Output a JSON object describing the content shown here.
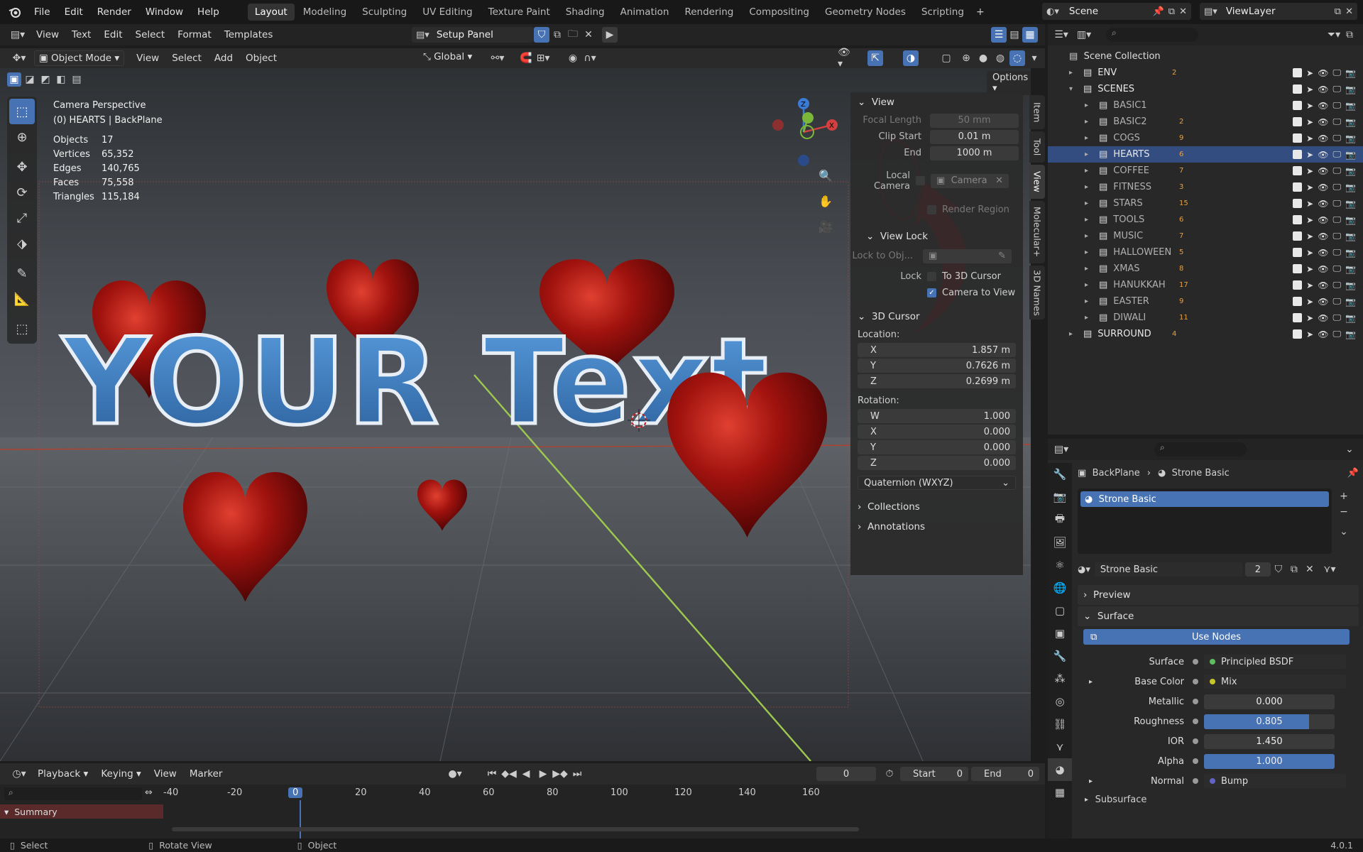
{
  "menubar": {
    "items": [
      "File",
      "Edit",
      "Render",
      "Window",
      "Help"
    ],
    "workspaces": [
      "Layout",
      "Modeling",
      "Sculpting",
      "UV Editing",
      "Texture Paint",
      "Shading",
      "Animation",
      "Rendering",
      "Compositing",
      "Geometry Nodes",
      "Scripting"
    ],
    "active_workspace": "Layout",
    "scene": "Scene",
    "view_layer": "ViewLayer"
  },
  "text_header": {
    "items": [
      "View",
      "Text",
      "Edit",
      "Select",
      "Format",
      "Templates"
    ],
    "script_name": "Setup Panel"
  },
  "viewport_header": {
    "mode": "Object Mode",
    "items": [
      "View",
      "Select",
      "Add",
      "Object"
    ],
    "orientation": "Global",
    "options": "Options"
  },
  "overlay_info": {
    "camera": "Camera Perspective",
    "context": "(0) HEARTS | BackPlane",
    "stats": [
      {
        "label": "Objects",
        "value": "17"
      },
      {
        "label": "Vertices",
        "value": "65,352"
      },
      {
        "label": "Edges",
        "value": "140,765"
      },
      {
        "label": "Faces",
        "value": "75,558"
      },
      {
        "label": "Triangles",
        "value": "115,184"
      }
    ]
  },
  "scene_text": "YOUR Text",
  "npanel": {
    "view_title": "View",
    "focal_label": "Focal Length",
    "focal_value": "50 mm",
    "clip_start_label": "Clip Start",
    "clip_start_value": "0.01 m",
    "end_label": "End",
    "end_value": "1000 m",
    "local_camera_label": "Local Camera",
    "local_camera_value": "Camera",
    "render_region": "Render Region",
    "view_lock_title": "View Lock",
    "lock_obj_label": "Lock to Obj...",
    "lock_label": "Lock",
    "to_cursor": "To 3D Cursor",
    "camera_to_view": "Camera to View",
    "cursor_title": "3D Cursor",
    "location_label": "Location:",
    "loc": [
      {
        "axis": "X",
        "value": "1.857 m"
      },
      {
        "axis": "Y",
        "value": "0.7626 m"
      },
      {
        "axis": "Z",
        "value": "0.2699 m"
      }
    ],
    "rotation_label": "Rotation:",
    "rot": [
      {
        "axis": "W",
        "value": "1.000"
      },
      {
        "axis": "X",
        "value": "0.000"
      },
      {
        "axis": "Y",
        "value": "0.000"
      },
      {
        "axis": "Z",
        "value": "0.000"
      }
    ],
    "rotation_mode": "Quaternion (WXYZ)",
    "collections": "Collections",
    "annotations": "Annotations",
    "tabs": [
      "Item",
      "Tool",
      "View",
      "Molecular+",
      "3D Names"
    ]
  },
  "outliner": {
    "root": "Scene Collection",
    "rows": [
      {
        "name": "ENV",
        "level": 1,
        "badge": "2"
      },
      {
        "name": "SCENES",
        "level": 1,
        "badge": ""
      },
      {
        "name": "BASIC1",
        "level": 2,
        "badge": ""
      },
      {
        "name": "BASIC2",
        "level": 2,
        "badge": "2"
      },
      {
        "name": "COGS",
        "level": 2,
        "badge": "9"
      },
      {
        "name": "HEARTS",
        "level": 2,
        "badge": "6"
      },
      {
        "name": "COFFEE",
        "level": 2,
        "badge": "7"
      },
      {
        "name": "FITNESS",
        "level": 2,
        "badge": "3"
      },
      {
        "name": "STARS",
        "level": 2,
        "badge": "15"
      },
      {
        "name": "TOOLS",
        "level": 2,
        "badge": "6"
      },
      {
        "name": "MUSIC",
        "level": 2,
        "badge": "7"
      },
      {
        "name": "HALLOWEEN",
        "level": 2,
        "badge": "5"
      },
      {
        "name": "XMAS",
        "level": 2,
        "badge": "8"
      },
      {
        "name": "HANUKKAH",
        "level": 2,
        "badge": "17"
      },
      {
        "name": "EASTER",
        "level": 2,
        "badge": "9"
      },
      {
        "name": "DIWALI",
        "level": 2,
        "badge": "11"
      },
      {
        "name": "SURROUND",
        "level": 1,
        "badge": "4"
      }
    ],
    "selected": "HEARTS"
  },
  "properties": {
    "breadcrumb_object": "BackPlane",
    "breadcrumb_material": "Strone Basic",
    "slot_name": "Strone Basic",
    "material_name": "Strone Basic",
    "users": "2",
    "preview": "Preview",
    "surface_section": "Surface",
    "use_nodes": "Use Nodes",
    "fields": [
      {
        "label": "Surface",
        "value": "Principled BSDF",
        "kind": "link",
        "color": "#5fbf5f"
      },
      {
        "label": "Base Color",
        "value": "Mix",
        "kind": "link",
        "color": "#c7c729"
      },
      {
        "label": "Metallic",
        "value": "0.000",
        "kind": "slider",
        "fill": 0.0
      },
      {
        "label": "Roughness",
        "value": "0.805",
        "kind": "slider",
        "fill": 0.805
      },
      {
        "label": "IOR",
        "value": "1.450",
        "kind": "slider",
        "fill": 0.0
      },
      {
        "label": "Alpha",
        "value": "1.000",
        "kind": "slider",
        "fill": 1.0
      },
      {
        "label": "Normal",
        "value": "Bump",
        "kind": "link",
        "color": "#6363c7"
      }
    ],
    "subsurface": "Subsurface"
  },
  "timeline": {
    "items": [
      "Playback",
      "Keying",
      "View",
      "Marker"
    ],
    "current_frame": "0",
    "start_label": "Start",
    "start_value": "0",
    "end_label": "End",
    "end_value": "0",
    "ruler": [
      "-40",
      "-20",
      "0",
      "20",
      "40",
      "60",
      "80",
      "100",
      "120",
      "140",
      "160"
    ],
    "summary": "Summary"
  },
  "statusbar": {
    "select": "Select",
    "rotate": "Rotate View",
    "object": "Object",
    "version": "4.0.1"
  },
  "colors": {
    "accent": "#4772b3",
    "selected_row": "#334d80",
    "annotation_red": "#e0101a"
  }
}
